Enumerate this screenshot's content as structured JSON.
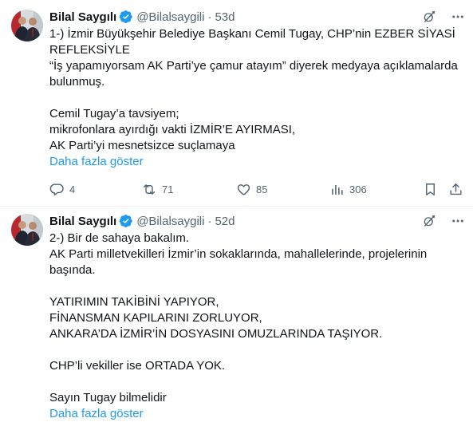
{
  "tweets": [
    {
      "author_name": "Bilal Saygılı",
      "handle": "@Bilalsaygili",
      "separator": "·",
      "time": "53d",
      "lines": [
        "1-) İzmir Büyükşehir Belediye Başkanı Cemil Tugay, CHP’nin EZBER SİYASİ",
        "REFLEKSİYLE",
        "“İş yapamıyorsam AK Parti’ye çamur atayım” diyerek medyaya açıklamalarda",
        "bulunmuş.",
        "",
        "Cemil Tugay’a tavsiyem;",
        "mikrofonlara ayırdığı vakti İZMİR’E AYIRMASI,",
        "AK Parti’yi mesnetsizce suçlamaya"
      ],
      "show_more": "Daha fazla göster",
      "stats": {
        "replies": "4",
        "reposts": "71",
        "likes": "85",
        "views": "306"
      }
    },
    {
      "author_name": "Bilal Saygılı",
      "handle": "@Bilalsaygili",
      "separator": "·",
      "time": "52d",
      "lines": [
        "2-) Bir de sahaya bakalım.",
        "AK Parti milletvekilleri İzmir’in sokaklarında, mahallelerinde, projelerinin",
        "başında.",
        "",
        "YATIRIMIN TAKİBİNİ YAPIYOR,",
        "FİNANSMAN KAPILARINI ZORLUYOR,",
        "ANKARA’DA İZMİR’İN DOSYASINI OMUZLARINDA TAŞIYOR.",
        "",
        "CHP’li vekiller ise ORTADA YOK.",
        "",
        "Sayın Tugay bilmelidir"
      ],
      "show_more": "Daha fazla göster"
    }
  ],
  "icons": {
    "verified": "verified-badge-icon",
    "grok": "grok-icon",
    "more": "more-dots-icon",
    "reply": "reply-icon",
    "repost": "repost-icon",
    "like": "like-icon",
    "views": "views-icon",
    "bookmark": "bookmark-icon",
    "share": "share-icon"
  },
  "colors": {
    "accent": "#1d9bf0",
    "secondary_text": "#536471",
    "primary_text": "#0f1419"
  }
}
